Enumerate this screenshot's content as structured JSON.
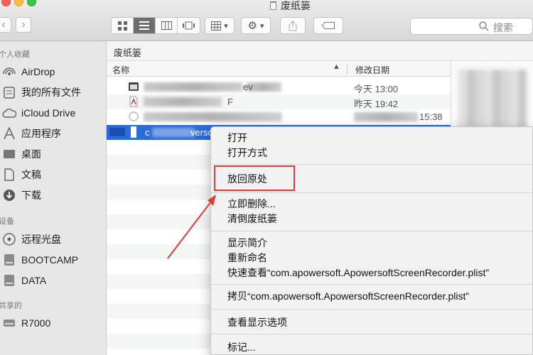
{
  "window": {
    "title": "废纸篓"
  },
  "toolbar": {
    "search_placeholder": "搜索",
    "back": "‹",
    "forward": "›"
  },
  "sidebar": {
    "section_favorites": "个人收藏",
    "section_devices": "设备",
    "section_shared": "共享的",
    "favorites": [
      {
        "label": "AirDrop",
        "icon": "airdrop-icon"
      },
      {
        "label": "我的所有文件",
        "icon": "all-files-icon"
      },
      {
        "label": "iCloud Drive",
        "icon": "cloud-icon"
      },
      {
        "label": "应用程序",
        "icon": "applications-icon"
      },
      {
        "label": "桌面",
        "icon": "desktop-icon"
      },
      {
        "label": "文稿",
        "icon": "documents-icon"
      },
      {
        "label": "下载",
        "icon": "downloads-icon"
      }
    ],
    "devices": [
      {
        "label": "远程光盘",
        "icon": "remote-disc-icon"
      },
      {
        "label": "BOOTCAMP",
        "icon": "drive-icon"
      },
      {
        "label": "DATA",
        "icon": "drive-icon"
      }
    ],
    "shared": [
      {
        "label": "R7000",
        "icon": "network-icon"
      }
    ]
  },
  "content": {
    "path": "废纸篓",
    "columns": {
      "name": "名称",
      "date": "修改日期"
    },
    "rows": [
      {
        "name_suffix": "ev",
        "date": "今天 13:00"
      },
      {
        "name_suffix": "F",
        "date": "昨天 19:42"
      },
      {
        "name_suffix": "",
        "date": "15:38"
      },
      {
        "name_prefix": "c",
        "name_suffix": "versc",
        "date": ""
      }
    ]
  },
  "context_menu": {
    "items": [
      "打开",
      "打开方式",
      "放回原处",
      "立即删除...",
      "清倒废纸篓",
      "显示简介",
      "重新命名",
      "快速查看“com.apowersoft.ApowersoftScreenRecorder.plist”",
      "拷贝“com.apowersoft.ApowersoftScreenRecorder.plist”",
      "查看显示选项",
      "标记..."
    ]
  },
  "colors": {
    "selection": "#2b6ad9",
    "highlight": "#e23b3b",
    "sidebar": "#e7e7e7"
  }
}
